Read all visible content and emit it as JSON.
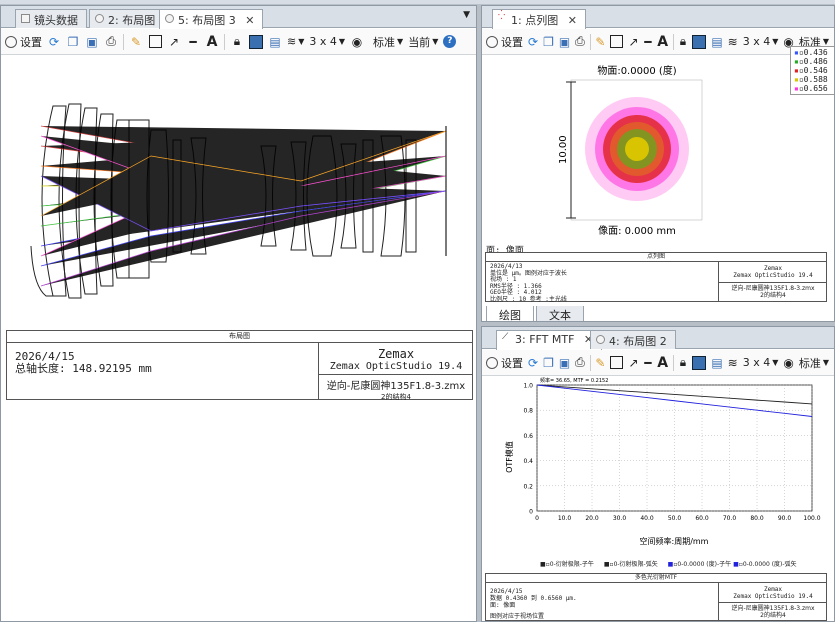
{
  "left_pane": {
    "tabs": [
      {
        "label": "镜头数据",
        "active": false
      },
      {
        "label": "2: 布局图",
        "active": false
      },
      {
        "label": "5: 布局图 3",
        "active": true
      }
    ],
    "toolbar": {
      "settings_label": "设置",
      "grid_label": "3 x 4",
      "standard_label": "标准",
      "current_label": "当前"
    },
    "info": {
      "header": "布局图",
      "date": "2026/4/15",
      "total_length": "总轴长度:  148.92195 mm",
      "brand": "Zemax",
      "product": "Zemax OpticStudio 19.4",
      "file": "逆向-尼康圆神135F1.8-3.zmx",
      "config": "2的结构4"
    }
  },
  "top_right_pane": {
    "tabs": [
      {
        "label": "1: 点列图",
        "active": true
      }
    ],
    "toolbar": {
      "settings_label": "设置",
      "grid_label": "3 x 4",
      "standard_label": "标准"
    },
    "spot": {
      "object_label": "物面:0.0000 (度)",
      "image_label": "像面: 0.000 mm",
      "scale_label": "10.00",
      "surface_label": "面: 像面",
      "wavelengths": [
        "0.436",
        "0.486",
        "0.546",
        "0.588",
        "0.656"
      ],
      "colors": [
        "#3355ff",
        "#22aa22",
        "#e02020",
        "#d8c400",
        "#ff33dd"
      ]
    },
    "info": {
      "header": "点列图",
      "date": "2026/4/13",
      "line1": "单位是 µm。图例对应于波长",
      "line2": "视场        :       1",
      "rms": "RMS半径   :     1.366",
      "geo": "GEO半径   :     4.012",
      "scale": "比例尺    :      10     参考  :主光线",
      "brand": "Zemax",
      "product": "Zemax OpticStudio 19.4",
      "file": "逆向-尼康圆神135F1.8-3.zmx",
      "config": "2的结构4"
    },
    "subtabs": [
      "绘图",
      "文本"
    ]
  },
  "bottom_right_pane": {
    "tabs": [
      {
        "label": "3: FFT MTF",
        "active": true
      },
      {
        "label": "4: 布局图 2",
        "active": false
      }
    ],
    "toolbar": {
      "settings_label": "设置",
      "grid_label": "3 x 4",
      "standard_label": "标准"
    },
    "legend": [
      "0-衍射极限-子午",
      "0-衍射极限-弧矢",
      "0-0.0000 (度)-子午",
      "0-0.0000 (度)-弧矢"
    ],
    "info": {
      "header": "多色光衍射MTF",
      "date": "2026/4/15",
      "line1": "数据 0.4360 到 0.6560 µm.",
      "line2": "面: 像面",
      "line3": "图例对应于视场位置",
      "brand": "Zemax",
      "product": "Zemax OpticStudio 19.4",
      "file": "逆向-尼康圆神135F1.8-3.zmx",
      "config": "2的结构4"
    }
  },
  "chart_data": {
    "type": "line",
    "annotation": "频率= 36.65, MTF = 0.2152",
    "xlabel": "空间频率:周期/mm",
    "ylabel": "OTF模值",
    "xlim": [
      0,
      100
    ],
    "ylim": [
      0,
      1.0
    ],
    "xticks": [
      "0",
      "10.0",
      "20.0",
      "30.0",
      "40.0",
      "50.0",
      "60.0",
      "70.0",
      "80.0",
      "90.0",
      "100.0"
    ],
    "yticks": [
      "0",
      "0.2",
      "0.4",
      "0.6",
      "0.8",
      "1.0"
    ],
    "grid": true,
    "x": [
      0,
      10,
      20,
      30,
      40,
      50,
      60,
      70,
      80,
      90,
      100
    ],
    "series": [
      {
        "name": "0-衍射极限-子午",
        "values": [
          1.0,
          0.985,
          0.97,
          0.955,
          0.94,
          0.925,
          0.91,
          0.895,
          0.88,
          0.865,
          0.85
        ],
        "color": "#222222"
      },
      {
        "name": "0-0.0000 (度)-子午",
        "values": [
          1.0,
          0.975,
          0.95,
          0.925,
          0.9,
          0.875,
          0.85,
          0.825,
          0.8,
          0.775,
          0.75
        ],
        "color": "#2222dd"
      }
    ]
  }
}
